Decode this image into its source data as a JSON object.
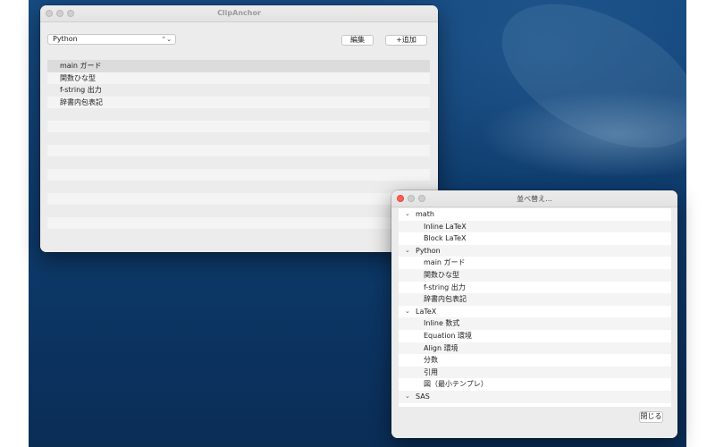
{
  "main_window": {
    "title": "ClipAnchor",
    "category_select": {
      "value": "Python",
      "chevron": "chevron-up-down-icon"
    },
    "edit_button": "編集",
    "add_button": "+追加",
    "snippets": [
      "main ガード",
      "関数ひな型",
      "f-string 出力",
      "辞書内包表記"
    ],
    "selected_index": 0,
    "empty_rows": 11
  },
  "sort_window": {
    "title": "並べ替え...",
    "groups": [
      {
        "name": "math",
        "items": [
          "Inline LaTeX",
          "Block LaTeX"
        ]
      },
      {
        "name": "Python",
        "items": [
          "main ガード",
          "関数ひな型",
          "f-string 出力",
          "辞書内包表記"
        ]
      },
      {
        "name": "LaTeX",
        "items": [
          "Inline 数式",
          "Equation 環境",
          "Align 環境",
          "分数",
          "引用",
          "図（最小テンプレ）"
        ]
      },
      {
        "name": "SAS",
        "items": []
      }
    ],
    "disclosure_icon": "chevron-down-icon",
    "close_button": "閉じる"
  },
  "colors": {
    "close_light": "#ff5f57",
    "desktop": "#0f3d6e",
    "selection": "#dcdcdc"
  }
}
